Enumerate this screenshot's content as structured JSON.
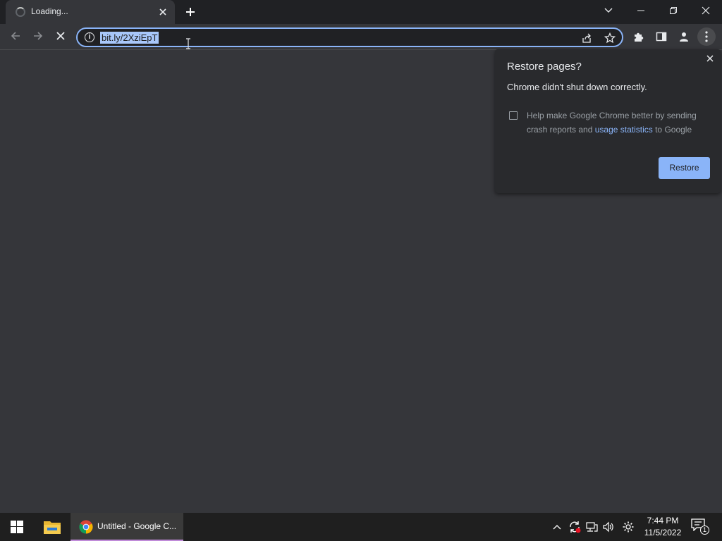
{
  "browser": {
    "tab": {
      "title": "Loading...",
      "close_icon": "close-icon"
    },
    "new_tab_icon": "plus-icon",
    "window_controls": [
      "chevron-down-icon",
      "minimize-icon",
      "restore-icon",
      "close-icon"
    ],
    "omnibox": {
      "url": "bit.ly/2XziEpT",
      "info_icon": "i"
    }
  },
  "restore_bubble": {
    "title": "Restore pages?",
    "message": "Chrome didn't shut down correctly.",
    "help_text_before": "Help make Google Chrome better by sending crash reports and ",
    "help_link": "usage statistics",
    "help_text_after": " to Google",
    "restore_label": "Restore",
    "close_icon": "×"
  },
  "taskbar": {
    "chrome_label": "Untitled - Google C...",
    "time": "7:44 PM",
    "date": "11/5/2022",
    "notification_count": "1"
  },
  "colors": {
    "accent": "#8ab4f8",
    "tab_strip": "#202124",
    "toolbar": "#35363a",
    "taskbar": "#1f1f1f"
  }
}
